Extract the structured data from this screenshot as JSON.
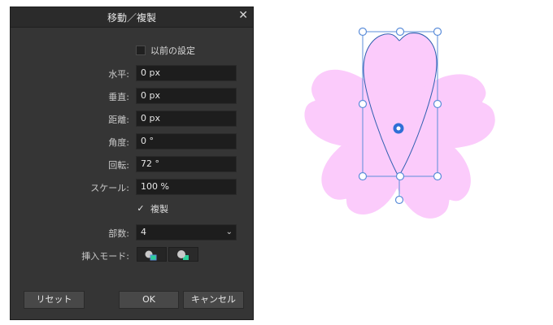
{
  "dialog": {
    "title": "移動／複製",
    "close_glyph": "✕",
    "use_previous_label": "以前の設定",
    "fields": {
      "horizontal": {
        "label": "水平:",
        "value": "0 px"
      },
      "vertical": {
        "label": "垂直:",
        "value": "0 px"
      },
      "distance": {
        "label": "距離:",
        "value": "0 px"
      },
      "angle": {
        "label": "角度:",
        "value": "0 °"
      },
      "rotation": {
        "label": "回転:",
        "value": "72 °"
      },
      "scale": {
        "label": "スケール:",
        "value": "100 %"
      }
    },
    "duplicate": {
      "label": "複製",
      "checked": true,
      "check_glyph": "✓"
    },
    "copies": {
      "label": "部数:",
      "value": "4",
      "arrow_glyph": "⌄"
    },
    "insert_mode": {
      "label": "挿入モード:"
    },
    "buttons": {
      "reset": "リセット",
      "ok": "OK",
      "cancel": "キャンセル"
    }
  },
  "canvas": {
    "flower_color": "#fbcbfb",
    "selection_color": "#5b8dd9",
    "pivot_color": "#2f6fd6"
  }
}
